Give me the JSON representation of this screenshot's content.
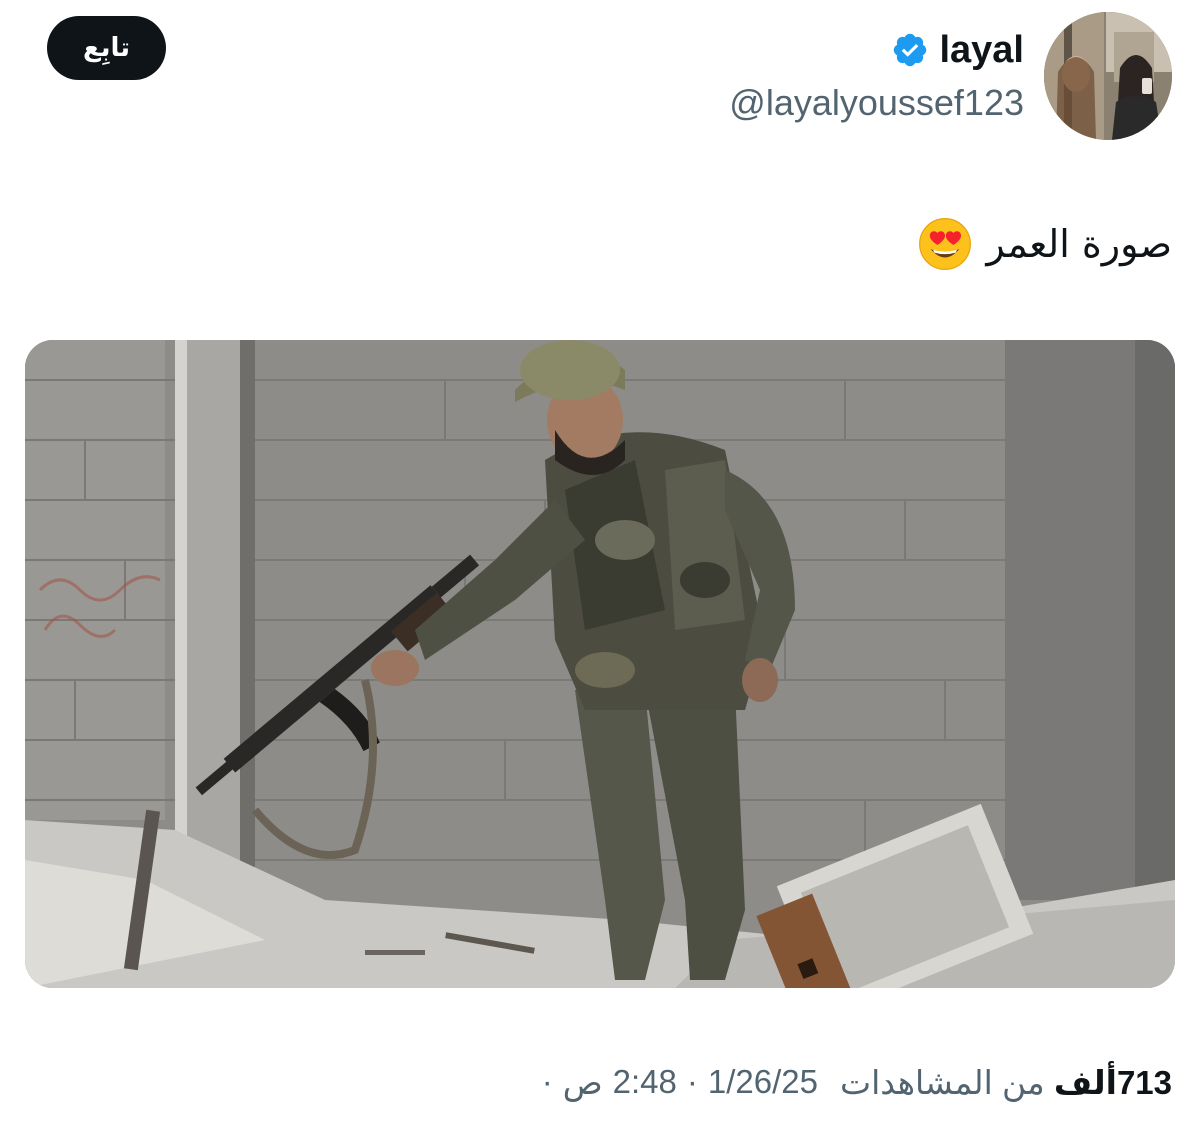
{
  "header": {
    "follow_label": "تابِع",
    "display_name": "layal",
    "handle": "@layalyoussef123",
    "verified_icon": "verified-badge-icon",
    "accent_color": "#1d9bf0"
  },
  "tweet": {
    "text": "صورة العمر",
    "emoji": "heart-eyes-emoji",
    "media_description_icon": "photo"
  },
  "meta": {
    "date": "1/26/25",
    "time": "2:48",
    "period": "ص",
    "separator": "·",
    "views_count": "713",
    "views_unit": "ألف",
    "views_suffix": "من المشاهدات"
  }
}
